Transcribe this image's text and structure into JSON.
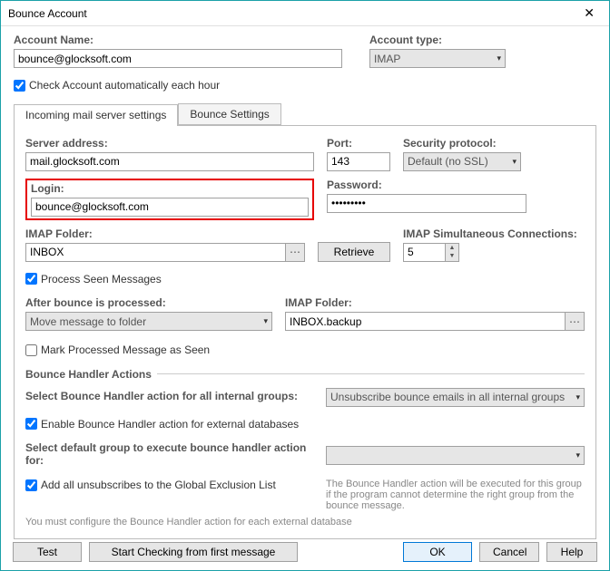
{
  "window": {
    "title": "Bounce Account"
  },
  "account": {
    "name_label": "Account Name:",
    "name_value": "bounce@glocksoft.com",
    "type_label": "Account type:",
    "type_value": "IMAP",
    "check_auto_label": "Check Account automatically each hour"
  },
  "tabs": {
    "incoming": "Incoming mail server settings",
    "bounce": "Bounce Settings"
  },
  "server": {
    "address_label": "Server address:",
    "address_value": "mail.glocksoft.com",
    "port_label": "Port:",
    "port_value": "143",
    "security_label": "Security protocol:",
    "security_value": "Default (no SSL)",
    "login_label": "Login:",
    "login_value": "bounce@glocksoft.com",
    "password_label": "Password:",
    "password_value": "•••••••••",
    "imap_folder_label": "IMAP Folder:",
    "imap_folder_value": "INBOX",
    "retrieve_label": "Retrieve",
    "sim_conn_label": "IMAP Simultaneous Connections:",
    "sim_conn_value": "5",
    "process_seen_label": "Process Seen Messages",
    "after_bounce_label": "After bounce is processed:",
    "after_bounce_value": "Move message to folder",
    "imap_folder2_label": "IMAP Folder:",
    "imap_folder2_value": "INBOX.backup",
    "mark_processed_label": "Mark Processed Message as Seen"
  },
  "actions": {
    "section_label": "Bounce Handler Actions",
    "select_action_label": "Select Bounce Handler action for all internal groups:",
    "select_action_value": "Unsubscribe bounce emails in all internal groups",
    "enable_external_label": "Enable Bounce Handler action for external databases",
    "default_group_label": "Select default group to execute bounce handler action for:",
    "default_group_value": "",
    "add_unsub_label": "Add all unsubscribes to the Global Exclusion List",
    "help_text": "The Bounce Handler action will be executed for this group if the program cannot determine the right group from the bounce message.",
    "config_note": "You must configure the Bounce Handler action for each external database"
  },
  "buttons": {
    "test": "Test",
    "start_checking": "Start Checking from first message",
    "ok": "OK",
    "cancel": "Cancel",
    "help": "Help"
  }
}
